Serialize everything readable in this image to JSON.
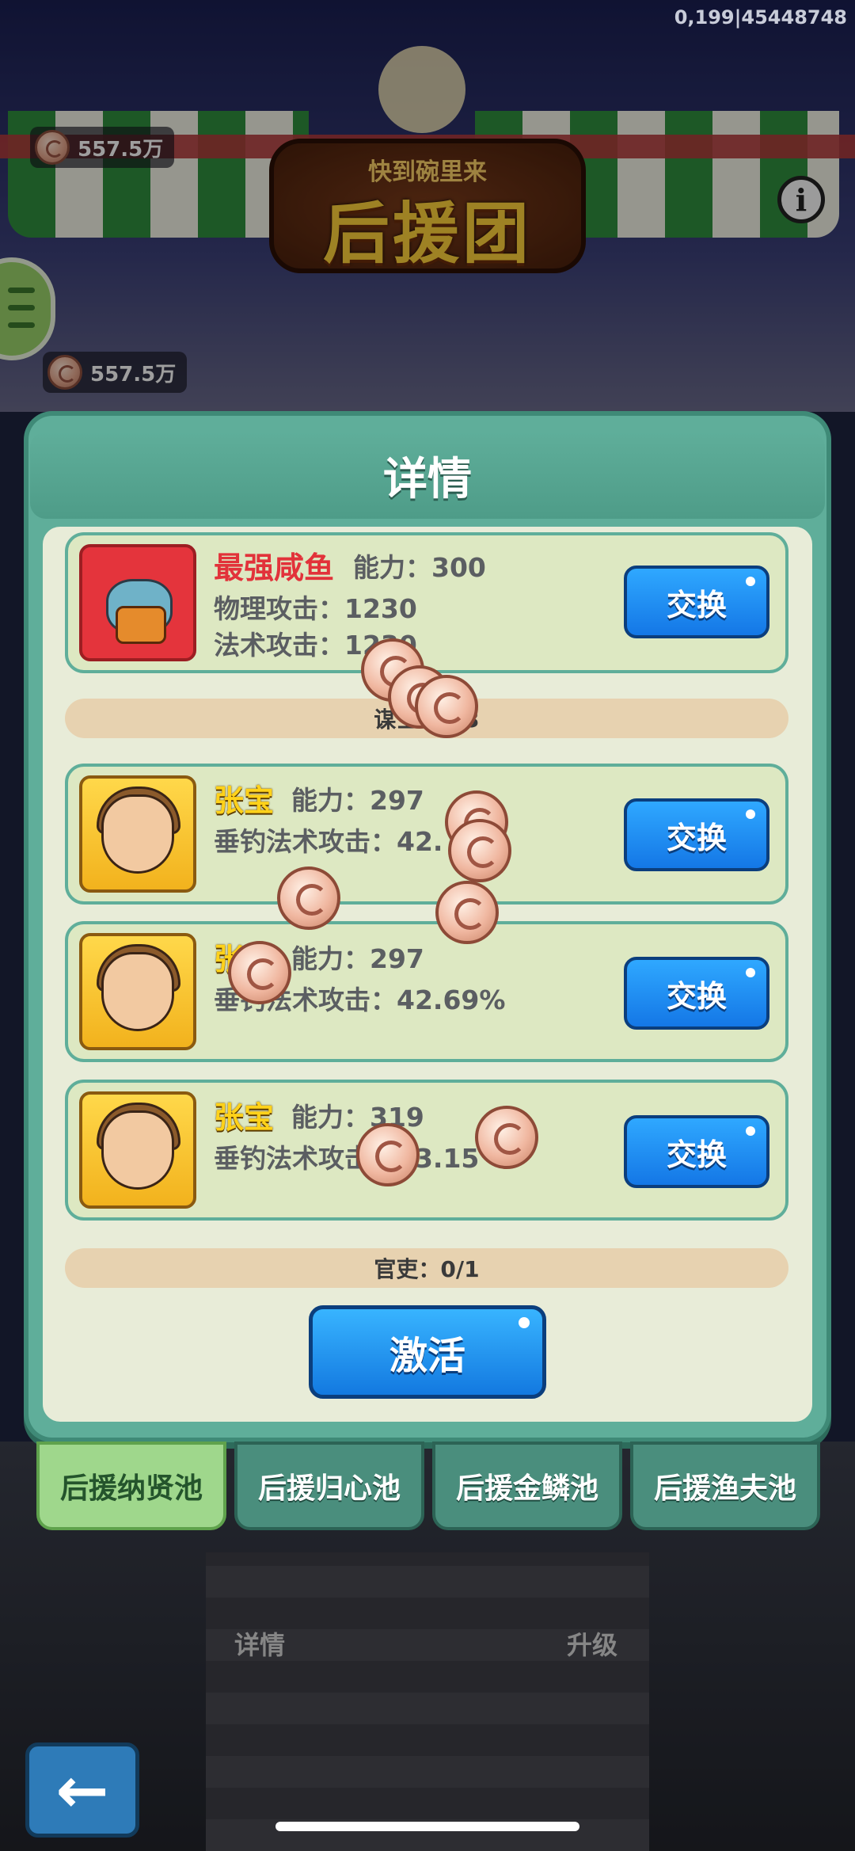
{
  "status_bar": {
    "debug_text": "0,199|45448748"
  },
  "currency": {
    "top_amount": "557.5万",
    "second_amount": "557.5万"
  },
  "banner": {
    "subtitle": "快到碗里来",
    "title": "后援团"
  },
  "modal": {
    "title": "详情",
    "entries": [
      {
        "name": "最强咸鱼",
        "ability": "能力：300",
        "line1": "物理攻击：1230",
        "line2": "法术攻击：1230",
        "button": "交换"
      },
      {
        "name": "张宝",
        "ability": "能力：297",
        "line1": "垂钓法术攻击：42.",
        "button": "交换"
      },
      {
        "name": "张宝",
        "ability": "能力：297",
        "line1": "垂钓法术攻击：42.69%",
        "button": "交换"
      },
      {
        "name": "张宝",
        "ability": "能力：319",
        "line1": "垂钓法术攻击：43.15",
        "button": "交换"
      }
    ],
    "divider_top": "谋士：0/3",
    "divider_bottom": "官吏：0/1",
    "activate_button": "激活"
  },
  "tabs": [
    {
      "label": "后援纳贤池",
      "active": true
    },
    {
      "label": "后援归心池",
      "active": false
    },
    {
      "label": "后援金鳞池",
      "active": false
    },
    {
      "label": "后援渔夫池",
      "active": false
    }
  ],
  "bottom": {
    "details_label": "详情",
    "upgrade_label": "升级"
  },
  "icons": {
    "info": "info-icon",
    "menu": "hamburger-menu-icon",
    "back": "back-arrow-icon",
    "coin": "coin-icon"
  },
  "colors": {
    "modal_green": "#5fae9a",
    "button_blue": "#1f8ef0",
    "name_red": "#e2323a",
    "name_yellow": "#ffd21a"
  }
}
